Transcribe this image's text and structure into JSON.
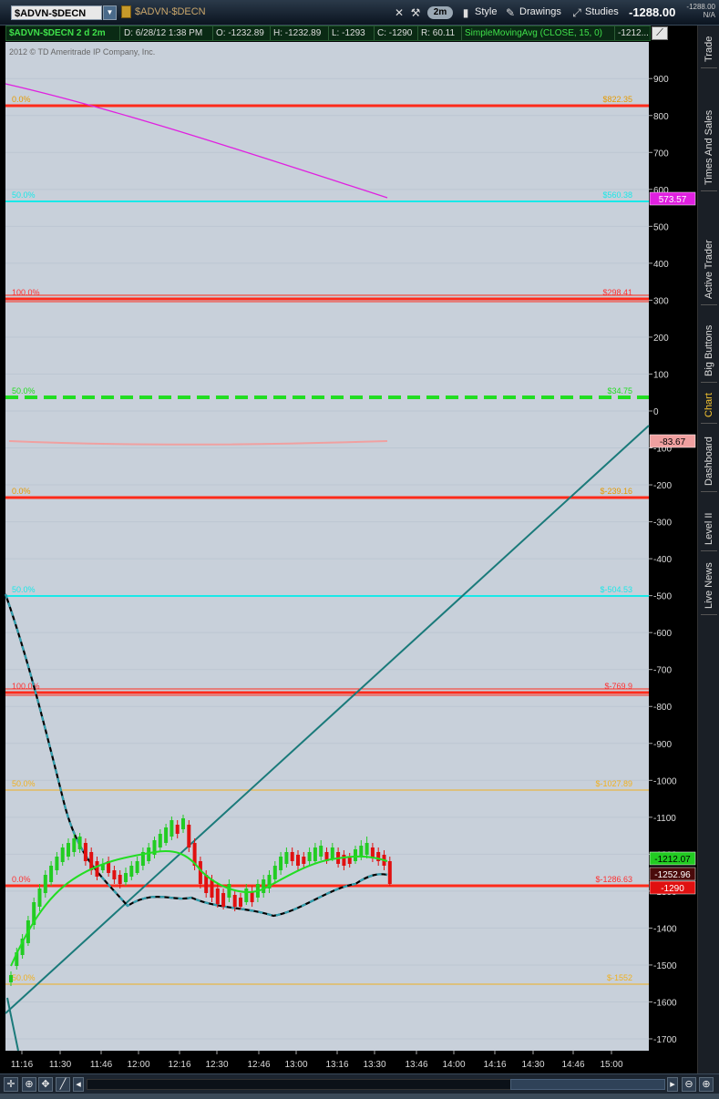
{
  "toolbar": {
    "symbol": "$ADVN-$DECN",
    "symbol_name": "$ADVN-$DECN",
    "aggregation": "2m",
    "style_label": "Style",
    "drawings_label": "Drawings",
    "studies_label": "Studies",
    "last_price": "-1288.00",
    "last_small_1": "-1288.00",
    "last_small_2": "N/A"
  },
  "infobar": {
    "title": "$ADVN-$DECN 2 d 2m",
    "date": "D: 6/28/12 1:38 PM",
    "open": "O: -1232.89",
    "high": "H: -1232.89",
    "low": "L: -1293",
    "close": "C: -1290",
    "range": "R: 60.11",
    "study": "SimpleMovingAvg (CLOSE, 15, 0)",
    "study_value": "-1212..."
  },
  "chart": {
    "copyright": "2012 © TD Ameritrade IP Company, Inc.",
    "y_ticks": [
      "900",
      "800",
      "700",
      "600",
      "500",
      "400",
      "300",
      "200",
      "100",
      "0",
      "-100",
      "-200",
      "-300",
      "-400",
      "-500",
      "-600",
      "-700",
      "-800",
      "-900",
      "-1000",
      "-1100",
      "-1200",
      "-1300",
      "-1400",
      "-1500",
      "-1600",
      "-1700"
    ],
    "x_ticks": [
      "11:16",
      "11:30",
      "11:46",
      "12:00",
      "12:16",
      "12:30",
      "12:46",
      "13:00",
      "13:16",
      "13:30",
      "13:46",
      "14:00",
      "14:16",
      "14:30",
      "14:46",
      "15:00"
    ],
    "fib_levels": [
      {
        "pct_left": "0.0%",
        "pct_right": "$822.35",
        "color": "#ff2a1a",
        "left_color": "#e69a00"
      },
      {
        "pct_left": "50.0%",
        "pct_right": "$560.38",
        "color": "#1ae8e8",
        "left_color": "#1ae8e8"
      },
      {
        "pct_left": "100.0%",
        "pct_right": "$298.41",
        "color": "#ff2a1a",
        "left_color": "#ff3030"
      },
      {
        "pct_left": "50.0%",
        "pct_right": "$34.75",
        "color": "#22dd22",
        "left_color": "#22dd22"
      },
      {
        "pct_left": "0.0%",
        "pct_right": "$-239.16",
        "color": "#ff2a1a",
        "left_color": "#e69a00"
      },
      {
        "pct_left": "50.0%",
        "pct_right": "$-504.53",
        "color": "#1ae8e8",
        "left_color": "#1ae8e8"
      },
      {
        "pct_left": "100.0%",
        "pct_right": "$-769.9",
        "color": "#ff2a1a",
        "left_color": "#ff3030"
      },
      {
        "pct_left": "50.0%",
        "pct_right": "$-1027.89",
        "color": "#f0b020",
        "left_color": "#f0b020"
      },
      {
        "pct_left": "0.0%",
        "pct_right": "$-1286.63",
        "color": "#ff2a1a",
        "left_color": "#ff3030"
      },
      {
        "pct_left": "50.0%",
        "pct_right": "$-1552",
        "color": "#f0b020",
        "left_color": "#f0b020"
      }
    ],
    "price_bubbles": [
      {
        "label": "573.57",
        "bg": "#e020e0",
        "fg": "#ffffff"
      },
      {
        "label": "-83.67",
        "bg": "#f0a0a0",
        "fg": "#000000"
      },
      {
        "label": "-1212.07",
        "bg": "#22cc22",
        "fg": "#000000"
      },
      {
        "label": "-1252.96",
        "bg": "#4a0a0a",
        "fg": "#ffffff"
      },
      {
        "label": "-1290",
        "bg": "#e01010",
        "fg": "#ffffff"
      }
    ],
    "colors": {
      "background": "#c8d0da",
      "up_bar": "#22cc22",
      "down_bar": "#e01010",
      "sma": "#22dd22",
      "dashed": "#30a0b0",
      "trendline": "#1a7a7a",
      "magenta": "#e020e0",
      "pink": "#f0a0a0"
    }
  },
  "right_tabs": [
    "Trade",
    "Times And Sales",
    "Active Trader",
    "Big Buttons",
    "Chart",
    "Dashboard",
    "Level II",
    "Live News"
  ],
  "bottom": {
    "buttons": [
      "crosshair-icon",
      "zoom-in-icon",
      "pan-icon",
      "draw-line-icon"
    ]
  }
}
